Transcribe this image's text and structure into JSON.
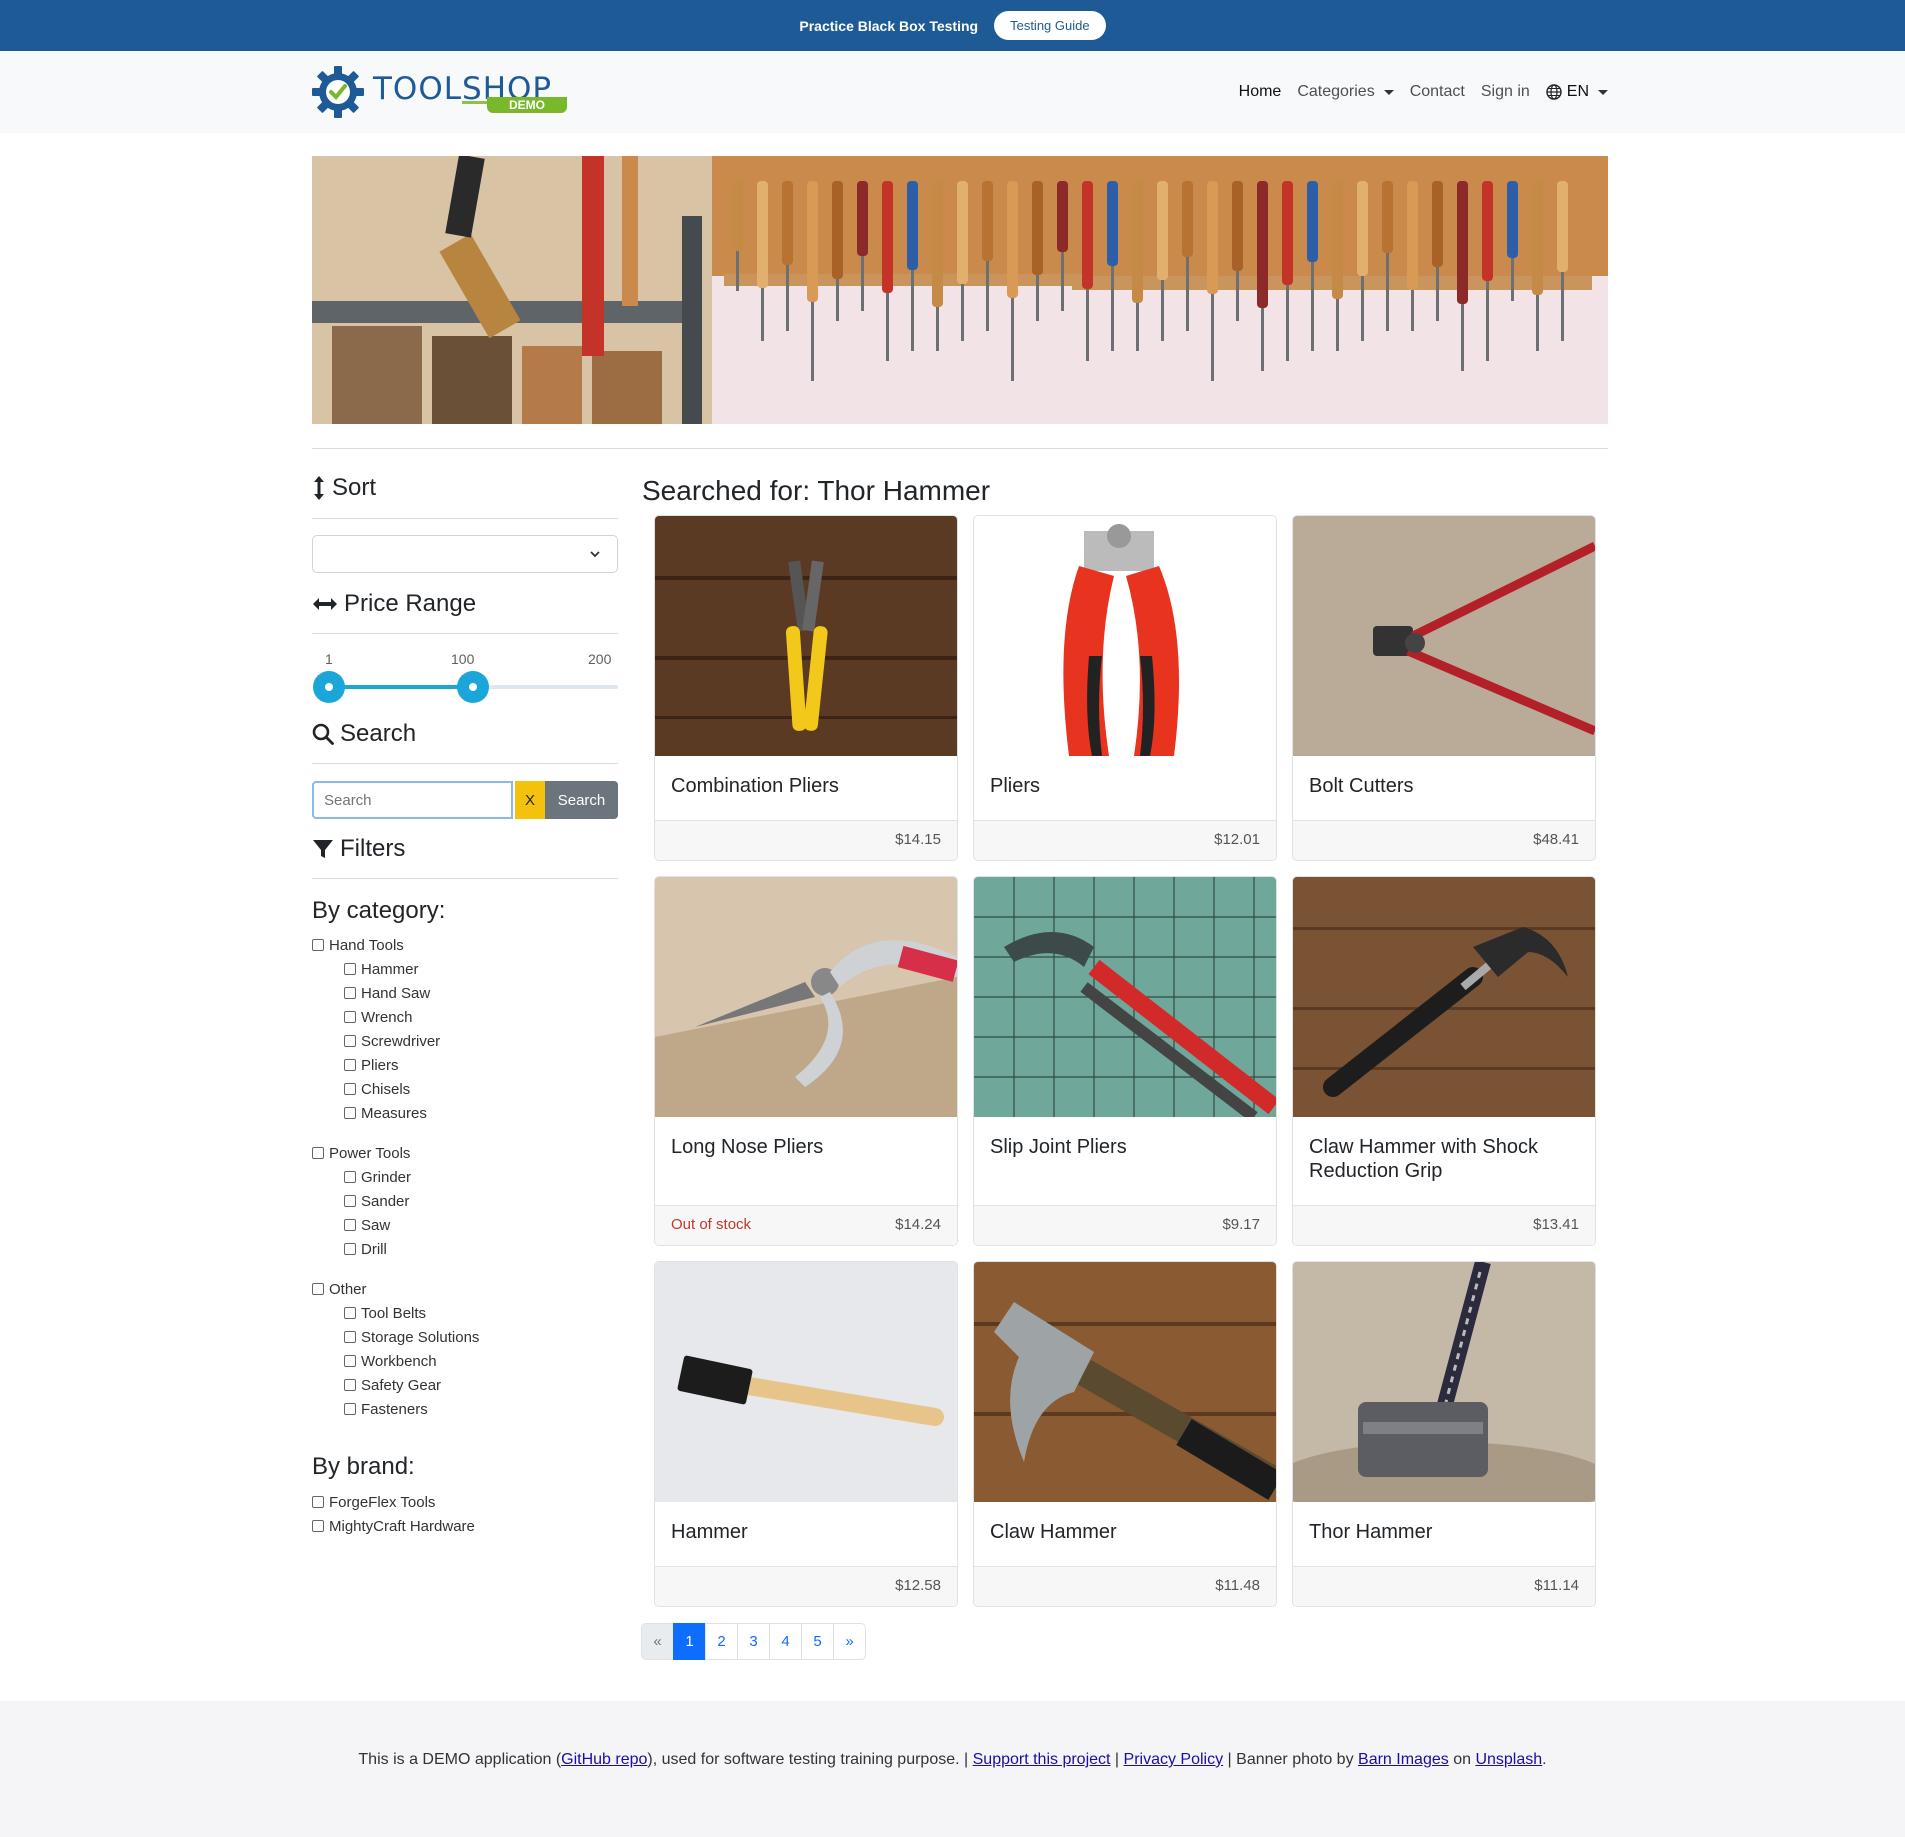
{
  "topbar": {
    "promo": "Practice Black Box Testing",
    "guide_button": "Testing Guide"
  },
  "logo": {
    "word_a": "TOOL",
    "word_b": "SHOP",
    "badge": "DEMO"
  },
  "nav": {
    "home": "Home",
    "categories": "Categories",
    "contact": "Contact",
    "sign_in": "Sign in",
    "language": "EN"
  },
  "sidebar": {
    "sort_heading": "Sort",
    "price_heading": "Price Range",
    "price_min_label": "1",
    "price_current_label": "100",
    "price_max_label": "200",
    "price_min": 1,
    "price_max": 200,
    "price_selected": [
      1,
      100
    ],
    "search_heading": "Search",
    "search_placeholder": "Search",
    "clear_button": "X",
    "search_button": "Search",
    "filters_heading": "Filters",
    "by_category": "By category:",
    "categories": [
      {
        "label": "Hand Tools",
        "children": [
          "Hammer",
          "Hand Saw",
          "Wrench",
          "Screwdriver",
          "Pliers",
          "Chisels",
          "Measures"
        ]
      },
      {
        "label": "Power Tools",
        "children": [
          "Grinder",
          "Sander",
          "Saw",
          "Drill"
        ]
      },
      {
        "label": "Other",
        "children": [
          "Tool Belts",
          "Storage Solutions",
          "Workbench",
          "Safety Gear",
          "Fasteners"
        ]
      }
    ],
    "by_brand": "By brand:",
    "brands": [
      "ForgeFlex Tools",
      "MightyCraft Hardware"
    ]
  },
  "results": {
    "title": "Searched for: Thor Hammer",
    "products": [
      {
        "name": "Combination Pliers",
        "price": "$14.15",
        "stock": ""
      },
      {
        "name": "Pliers",
        "price": "$12.01",
        "stock": ""
      },
      {
        "name": "Bolt Cutters",
        "price": "$48.41",
        "stock": ""
      },
      {
        "name": "Long Nose Pliers",
        "price": "$14.24",
        "stock": "Out of stock"
      },
      {
        "name": "Slip Joint Pliers",
        "price": "$9.17",
        "stock": ""
      },
      {
        "name": "Claw Hammer with Shock Reduction Grip",
        "price": "$13.41",
        "stock": ""
      },
      {
        "name": "Hammer",
        "price": "$12.58",
        "stock": ""
      },
      {
        "name": "Claw Hammer",
        "price": "$11.48",
        "stock": ""
      },
      {
        "name": "Thor Hammer",
        "price": "$11.14",
        "stock": ""
      }
    ]
  },
  "pagination": {
    "prev": "«",
    "pages": [
      "1",
      "2",
      "3",
      "4",
      "5"
    ],
    "next": "»",
    "current": "1"
  },
  "footer": {
    "t1": "This is a DEMO application (",
    "github": "GitHub repo",
    "t2": "), used for software testing training purpose. | ",
    "support": "Support this project",
    "t3": " | ",
    "privacy": "Privacy Policy",
    "t4": " | Banner photo by ",
    "barn": "Barn Images",
    "t5": " on ",
    "unsplash": "Unsplash",
    "t6": "."
  },
  "colors": {
    "topbar": "#1e5b96",
    "accent": "#1aa6d8",
    "primary": "#0d6efd",
    "out_of_stock": "#c0392b",
    "logo_badge": "#79b82a"
  },
  "icons": [
    "gear-check-logo-icon",
    "globe-icon",
    "sort-arrows-icon",
    "horizontal-arrows-icon",
    "magnifier-icon",
    "funnel-icon",
    "chevron-down-icon"
  ]
}
